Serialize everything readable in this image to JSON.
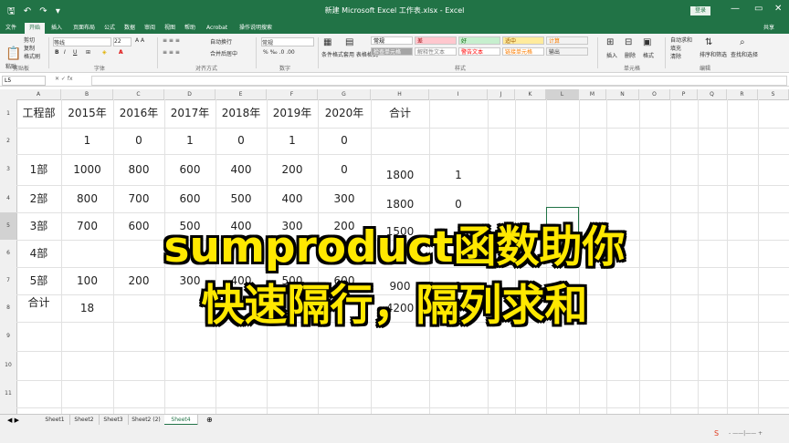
{
  "title_bar": {
    "title": "新建 Microsoft Excel 工作表.xlsx - Excel",
    "login": "登录",
    "quick_access": "🖫 ↶ ↷ ▾"
  },
  "tabs": [
    "文件",
    "开始",
    "插入",
    "页面布局",
    "公式",
    "数据",
    "审阅",
    "视图",
    "帮助",
    "Acrobat",
    "操作说明搜索",
    "共享"
  ],
  "ribbon": {
    "clipboard": {
      "cut": "剪切",
      "copy": "复制",
      "format_painter": "格式刷",
      "paste": "粘贴",
      "group": "剪贴板"
    },
    "font": {
      "name": "等线",
      "size": "22",
      "group": "字体"
    },
    "alignment": {
      "wrap": "自动换行",
      "merge": "合并后居中",
      "group": "对齐方式"
    },
    "number": {
      "format": "常规",
      "group": "数字"
    },
    "styles": {
      "conditional": "条件格式",
      "table": "套用\n表格格式",
      "cells": [
        {
          "label": "常规",
          "bg": "#ffffff",
          "color": "#000000"
        },
        {
          "label": "差",
          "bg": "#ffc7ce",
          "color": "#9c0006"
        },
        {
          "label": "好",
          "bg": "#c6efce",
          "color": "#006100"
        },
        {
          "label": "适中",
          "bg": "#ffeb9c",
          "color": "#9c5700"
        },
        {
          "label": "计算",
          "bg": "#f2f2f2",
          "color": "#fa7d00"
        },
        {
          "label": "检查单元格",
          "bg": "#a5a5a5",
          "color": "#ffffff"
        },
        {
          "label": "解释性文本",
          "bg": "#ffffff",
          "color": "#7f7f7f"
        },
        {
          "label": "警告文本",
          "bg": "#ffffff",
          "color": "#ff0000"
        },
        {
          "label": "链接单元格",
          "bg": "#ffffff",
          "color": "#fa7d00"
        },
        {
          "label": "输出",
          "bg": "#f2f2f2",
          "color": "#3f3f3f"
        }
      ],
      "group": "样式"
    },
    "cells_group": {
      "insert": "插入",
      "delete": "删除",
      "format": "格式",
      "group": "单元格"
    },
    "editing": {
      "autosum": "自动求和",
      "fill": "填充",
      "clear": "清除",
      "sort": "排序和筛选",
      "find": "查找和选择",
      "group": "编辑"
    }
  },
  "name_box": "L5",
  "columns": [
    "A",
    "B",
    "C",
    "D",
    "E",
    "F",
    "G",
    "H",
    "I",
    "J",
    "K",
    "L",
    "M",
    "N",
    "O",
    "P",
    "Q",
    "R",
    "S"
  ],
  "rows": [
    "1",
    "2",
    "3",
    "4",
    "5",
    "6",
    "7",
    "8",
    "9",
    "10",
    "11"
  ],
  "table": {
    "header": [
      "工程部",
      "2015年",
      "2016年",
      "2017年",
      "2018年",
      "2019年",
      "2020年",
      "合计"
    ],
    "flags": [
      "1",
      "0",
      "1",
      "0",
      "1",
      "0"
    ],
    "data": [
      {
        "label": "1部",
        "values": [
          "1000",
          "800",
          "600",
          "400",
          "200",
          "0"
        ],
        "total": "1800",
        "i": "1"
      },
      {
        "label": "2部",
        "values": [
          "800",
          "700",
          "600",
          "500",
          "400",
          "300"
        ],
        "total": "1800",
        "i": "0"
      },
      {
        "label": "3部",
        "values": [
          "700",
          "600",
          "500",
          "400",
          "300",
          "200"
        ],
        "total": "1500",
        "i": ""
      },
      {
        "label": "4部",
        "values": [
          "",
          "",
          "",
          "",
          "",
          ""
        ],
        "total": "",
        "i": ""
      },
      {
        "label": "5部",
        "values": [
          "100",
          "200",
          "300",
          "400",
          "500",
          "600"
        ],
        "total": "900",
        "i": "1"
      }
    ],
    "total_row": {
      "label": "合计",
      "first": "18",
      "total": "4200"
    }
  },
  "sheets": [
    "Sheet1",
    "Sheet2",
    "Sheet3",
    "Sheet2 (2)",
    "Sheet4"
  ],
  "active_sheet_index": 4,
  "overlay": {
    "line1": "sumproduct函数助你",
    "line2": "快速隔行，隔列求和"
  }
}
